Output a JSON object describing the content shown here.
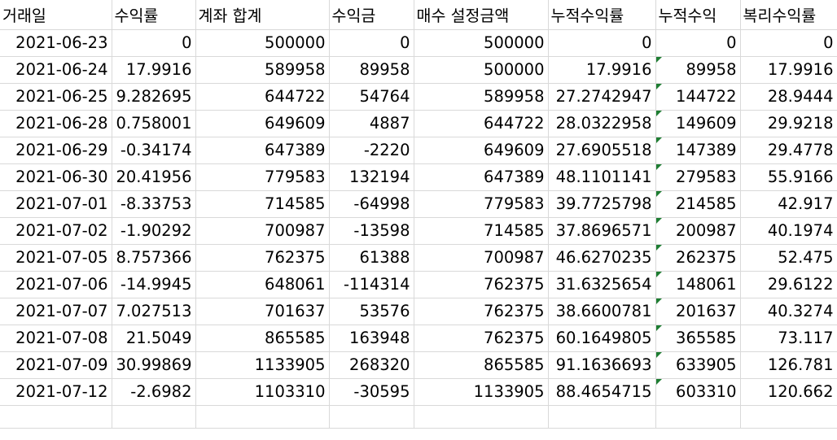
{
  "sheet": {
    "columns": [
      "거래일",
      "수익률",
      "계좌 합계",
      "수익금",
      "매수 설정금액",
      "누적수익률",
      "누적수익",
      "복리수익률"
    ],
    "rows": [
      [
        "2021-06-23",
        "0",
        "500000",
        "0",
        "500000",
        "0",
        "0",
        "0"
      ],
      [
        "2021-06-24",
        "17.9916",
        "589958",
        "89958",
        "500000",
        "17.9916",
        "89958",
        "17.9916"
      ],
      [
        "2021-06-25",
        "9.282695",
        "644722",
        "54764",
        "589958",
        "27.2742947",
        "144722",
        "28.9444"
      ],
      [
        "2021-06-28",
        "0.758001",
        "649609",
        "4887",
        "644722",
        "28.0322958",
        "149609",
        "29.9218"
      ],
      [
        "2021-06-29",
        "-0.34174",
        "647389",
        "-2220",
        "649609",
        "27.6905518",
        "147389",
        "29.4778"
      ],
      [
        "2021-06-30",
        "20.41956",
        "779583",
        "132194",
        "647389",
        "48.1101141",
        "279583",
        "55.9166"
      ],
      [
        "2021-07-01",
        "-8.33753",
        "714585",
        "-64998",
        "779583",
        "39.7725798",
        "214585",
        "42.917"
      ],
      [
        "2021-07-02",
        "-1.90292",
        "700987",
        "-13598",
        "714585",
        "37.8696571",
        "200987",
        "40.1974"
      ],
      [
        "2021-07-05",
        "8.757366",
        "762375",
        "61388",
        "700987",
        "46.6270235",
        "262375",
        "52.475"
      ],
      [
        "2021-07-06",
        "-14.9945",
        "648061",
        "-114314",
        "762375",
        "31.6325654",
        "148061",
        "29.6122"
      ],
      [
        "2021-07-07",
        "7.027513",
        "701637",
        "53576",
        "762375",
        "38.6600781",
        "201637",
        "40.3274"
      ],
      [
        "2021-07-08",
        "21.5049",
        "865585",
        "163948",
        "762375",
        "60.1649805",
        "365585",
        "73.117"
      ],
      [
        "2021-07-09",
        "30.99869",
        "1133905",
        "268320",
        "865585",
        "91.1636693",
        "633905",
        "126.781"
      ],
      [
        "2021-07-12",
        "-2.6982",
        "1103310",
        "-30595",
        "1133905",
        "88.4654715",
        "603310",
        "120.662"
      ]
    ],
    "error_indicator_color": "#1e7d32"
  }
}
